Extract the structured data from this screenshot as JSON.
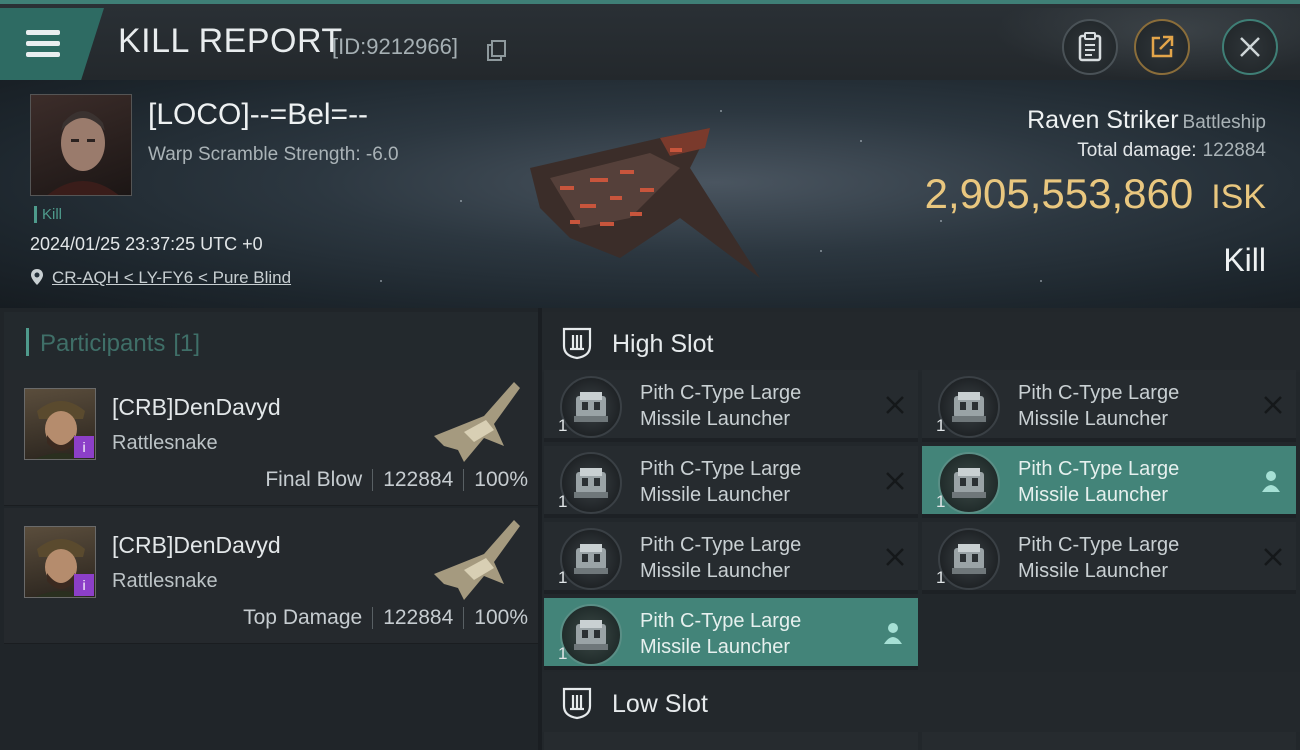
{
  "header": {
    "title": "KILL REPORT",
    "report_id": "[ID:9212966]"
  },
  "victim": {
    "name": "[LOCO]--=Bel=--",
    "warp_scramble": "Warp Scramble Strength: -6.0",
    "kill_tag": "Kill",
    "timestamp": "2024/01/25 23:37:25 UTC +0",
    "location": "CR-AQH < LY-FY6 < Pure Blind",
    "ship_name": "Raven Striker",
    "ship_class": "Battleship",
    "total_damage_label": "Total damage:",
    "total_damage": "122884",
    "isk_value": "2,905,553,860",
    "isk_currency": "ISK",
    "result": "Kill"
  },
  "participants": {
    "label": "Participants",
    "count": "[1]",
    "rows": [
      {
        "name": "[CRB]DenDavyd",
        "ship": "Rattlesnake",
        "role": "Final Blow",
        "damage": "122884",
        "percent": "100%",
        "badge": "i"
      },
      {
        "name": "[CRB]DenDavyd",
        "ship": "Rattlesnake",
        "role": "Top Damage",
        "damage": "122884",
        "percent": "100%",
        "badge": "i"
      }
    ]
  },
  "fitting": {
    "high_slot_label": "High Slot",
    "low_slot_label": "Low Slot",
    "high_modules": [
      {
        "line1": "Pith C-Type Large",
        "line2": "Missile Launcher",
        "qty": "1",
        "state": "destroyed"
      },
      {
        "line1": "Pith C-Type Large",
        "line2": "Missile Launcher",
        "qty": "1",
        "state": "destroyed"
      },
      {
        "line1": "Pith C-Type Large",
        "line2": "Missile Launcher",
        "qty": "1",
        "state": "destroyed"
      },
      {
        "line1": "Pith C-Type Large",
        "line2": "Missile Launcher",
        "qty": "1",
        "state": "dropped"
      },
      {
        "line1": "Pith C-Type Large",
        "line2": "Missile Launcher",
        "qty": "1",
        "state": "destroyed"
      },
      {
        "line1": "Pith C-Type Large",
        "line2": "Missile Launcher",
        "qty": "1",
        "state": "destroyed"
      },
      {
        "line1": "Pith C-Type Large",
        "line2": "Missile Launcher",
        "qty": "1",
        "state": "dropped"
      }
    ]
  },
  "colors": {
    "accent": "#438479",
    "isk": "#e9c77f",
    "badge": "#8c3fc8"
  }
}
